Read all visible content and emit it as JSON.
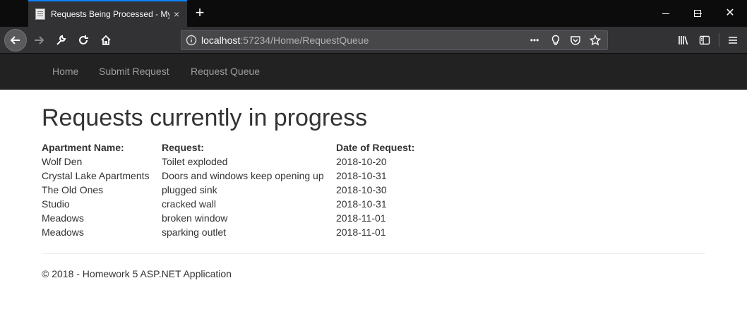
{
  "browser": {
    "tab_title": "Requests Being Processed - My ASP.NET Application",
    "tab_close": "×",
    "new_tab": "+",
    "url_host": "localhost",
    "url_rest": ":57234/Home/RequestQueue",
    "url_more": "•••"
  },
  "nav": {
    "items": [
      {
        "label": "Home"
      },
      {
        "label": "Submit Request"
      },
      {
        "label": "Request Queue"
      }
    ]
  },
  "page": {
    "title": "Requests currently in progress",
    "columns": [
      "Apartment Name:",
      "Request:",
      "Date of Request:"
    ],
    "rows": [
      [
        "Wolf Den",
        "Toilet exploded",
        "2018-10-20"
      ],
      [
        "Crystal Lake Apartments",
        "Doors and windows keep opening up",
        "2018-10-31"
      ],
      [
        "The Old Ones",
        "plugged sink",
        "2018-10-30"
      ],
      [
        "Studio",
        "cracked wall",
        "2018-10-31"
      ],
      [
        "Meadows",
        "broken window",
        "2018-11-01"
      ],
      [
        "Meadows",
        "sparking outlet",
        "2018-11-01"
      ]
    ],
    "footer": "© 2018 - Homework 5 ASP.NET Application"
  },
  "colors": {
    "tab_accent": "#0a84ff",
    "navbar_bg": "#222222",
    "nav_link": "#9d9d9d",
    "text": "#333333"
  }
}
